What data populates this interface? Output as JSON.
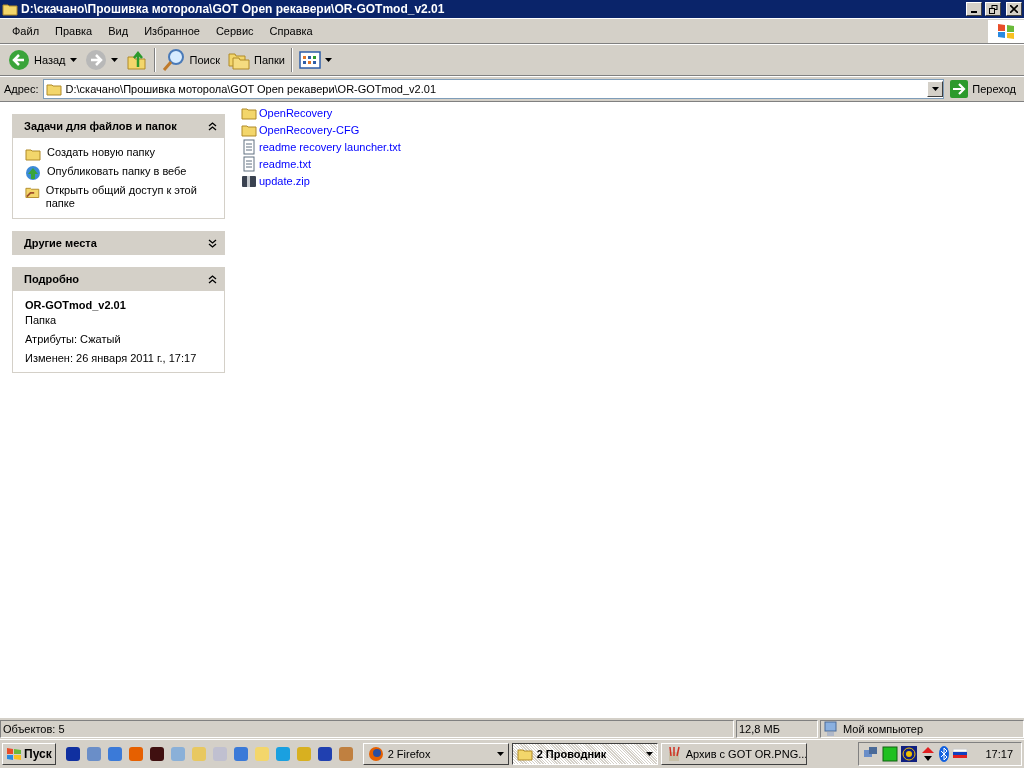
{
  "window": {
    "title": "D:\\скачано\\Прошивка моторола\\GOT Open рекавери\\OR-GOTmod_v2.01"
  },
  "menu": [
    "Файл",
    "Правка",
    "Вид",
    "Избранное",
    "Сервис",
    "Справка"
  ],
  "toolbar": [
    {
      "kind": "back",
      "label": "Назад",
      "disabled": false
    },
    {
      "kind": "forward",
      "disabled": true
    },
    {
      "kind": "up"
    },
    {
      "kind": "search",
      "label": "Поиск"
    },
    {
      "kind": "folders",
      "label": "Папки"
    },
    {
      "kind": "views"
    }
  ],
  "address": {
    "label": "Адрес:",
    "value": "D:\\скачано\\Прошивка моторола\\GOT Open рекавери\\OR-GOTmod_v2.01",
    "go": "Переход"
  },
  "panels": [
    {
      "title": "Задачи для файлов и папок",
      "expanded": true,
      "items": [
        {
          "kind": "new-folder",
          "label": "Создать новую папку"
        },
        {
          "kind": "publish",
          "label": "Опубликовать папку в вебе"
        },
        {
          "kind": "share",
          "label": "Открыть общий доступ к этой папке"
        }
      ]
    },
    {
      "title": "Другие места",
      "expanded": false
    },
    {
      "title": "Подробно",
      "expanded": true,
      "details": {
        "name": "OR-GOTmod_v2.01",
        "type": "Папка",
        "lines": [
          "Атрибуты: Сжатый",
          "Изменен: 26 января 2011 г., 17:17"
        ]
      }
    }
  ],
  "files": [
    {
      "kind": "folder",
      "name": "OpenRecovery"
    },
    {
      "kind": "folder",
      "name": "OpenRecovery-CFG"
    },
    {
      "kind": "text",
      "name": "readme recovery launcher.txt"
    },
    {
      "kind": "text",
      "name": "readme.txt"
    },
    {
      "kind": "zip",
      "name": "update.zip"
    }
  ],
  "status_bar": {
    "count": "Объектов: 5",
    "size": "12,8 МБ",
    "zone": "Мой компьютер"
  },
  "taskbar": {
    "start": "Пуск",
    "tasks": [
      {
        "kind": "firefox",
        "label": "2 Firefox",
        "group": true,
        "selected": false
      },
      {
        "kind": "folder",
        "label": "2 Проводник",
        "group": true,
        "selected": true
      },
      {
        "kind": "paint",
        "label": "Архив с GOT OR.PNG...",
        "group": false,
        "selected": false
      }
    ],
    "clock": "17:17"
  }
}
